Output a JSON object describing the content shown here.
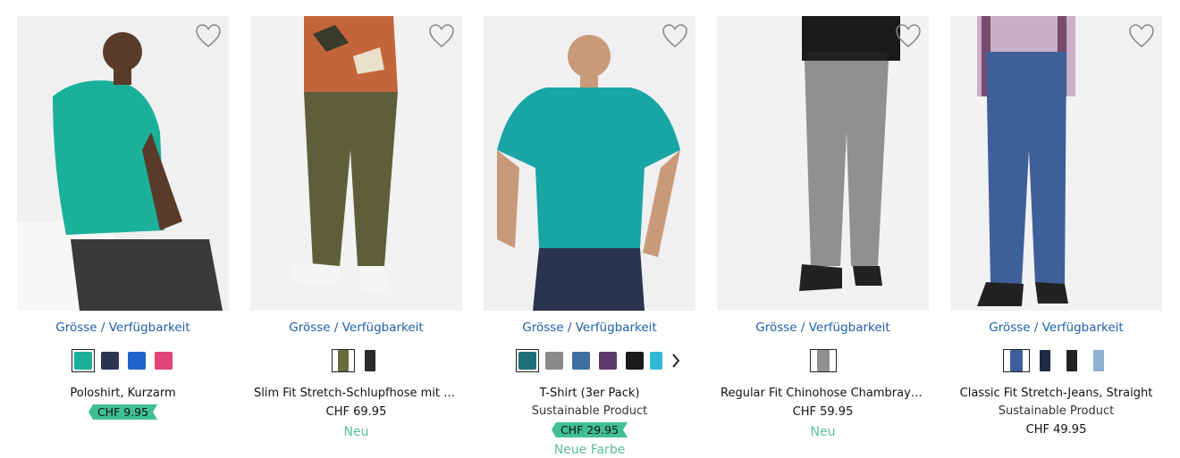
{
  "products": [
    {
      "name": "Poloshirt, Kurzarm",
      "subtitle": "",
      "price": "CHF 9.95",
      "price_sale": true,
      "badge": "",
      "availability_label": "Grösse / Verfügbarkeit",
      "colors": [
        "#1ab19a",
        "#2b3550",
        "#1f64c8",
        "#e0457a"
      ],
      "selected_color": 0,
      "more_colors": false
    },
    {
      "name": "Slim Fit Stretch-Schlupfhose mit C...",
      "subtitle": "",
      "price": "CHF 69.95",
      "price_sale": false,
      "badge": "Neu",
      "availability_label": "Grösse / Verfügbarkeit",
      "colors": [
        "#6a6a3a",
        "#2a2a2a"
      ],
      "selected_color": 0,
      "more_colors": false
    },
    {
      "name": "T-Shirt (3er Pack)",
      "subtitle": "Sustainable Product",
      "price": "CHF 29.95",
      "price_sale": true,
      "badge": "Neue Farbe",
      "availability_label": "Grösse / Verfügbarkeit",
      "colors": [
        "#1f6f78",
        "#8a8a8a",
        "#3f6fa0",
        "#5a3a6a",
        "#1a1a1a",
        "#2fb8d8"
      ],
      "selected_color": 0,
      "more_colors": true
    },
    {
      "name": "Regular Fit Chinohose Chambray m...",
      "subtitle": "",
      "price": "CHF 59.95",
      "price_sale": false,
      "badge": "Neu",
      "availability_label": "Grösse / Verfügbarkeit",
      "colors": [
        "#8e9092"
      ],
      "selected_color": 0,
      "more_colors": false
    },
    {
      "name": "Classic Fit Stretch-Jeans, Straight",
      "subtitle": "Sustainable Product",
      "price": "CHF 49.95",
      "price_sale": false,
      "badge": "",
      "availability_label": "Grösse / Verfügbarkeit",
      "colors": [
        "#3e5f9a",
        "#1e2a44",
        "#222222",
        "#8fb0d0"
      ],
      "selected_color": 0,
      "more_colors": false
    }
  ],
  "icons": {
    "wishlist": "heart-outline-icon",
    "next": "chevron-right-icon"
  },
  "colors": {
    "link": "#1f5fa8",
    "sale_tag": "#3fbf93",
    "badge": "#5cbf98"
  }
}
